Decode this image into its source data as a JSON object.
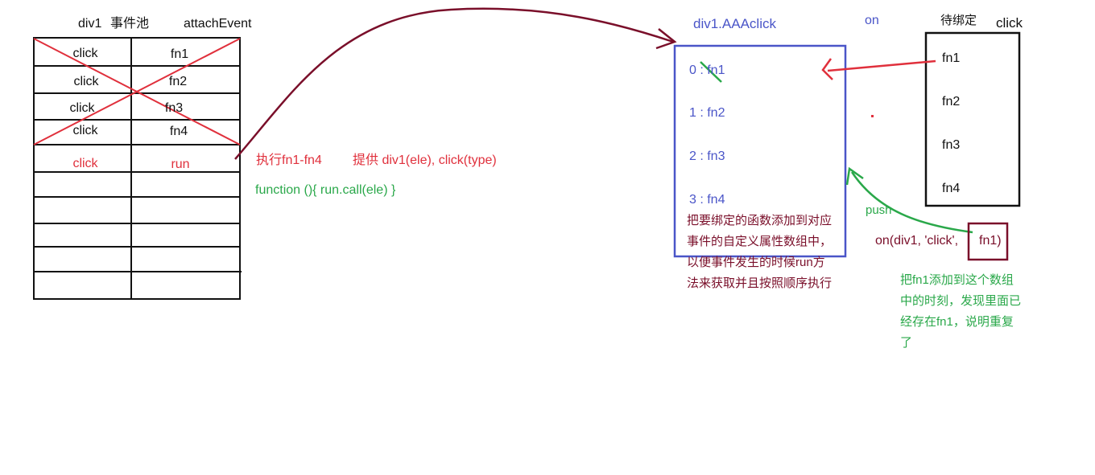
{
  "pool_table": {
    "header_div": "div1",
    "header_pool": "事件池",
    "header_api": "attachEvent",
    "rows": [
      {
        "type": "click",
        "fn": "fn1",
        "color": "#111111"
      },
      {
        "type": "click",
        "fn": "fn2",
        "color": "#111111"
      },
      {
        "type": "click",
        "fn": "fn3",
        "color": "#111111"
      },
      {
        "type": "click",
        "fn": "fn4",
        "color": "#111111"
      },
      {
        "type": "click",
        "fn": "run",
        "color": "#e0303c"
      }
    ]
  },
  "middle": {
    "exec_label": "执行fn1-fn4",
    "provide_label": "提供 div1(ele), click(type)",
    "function_label": "function (){  run.call(ele)  }"
  },
  "array_box": {
    "title": "div1.AAAclick",
    "items": [
      "0 : fn1",
      "1 : fn2",
      "2 : fn3",
      "3 : fn4"
    ],
    "note_lines": [
      "把要绑定的函数添加到对应",
      "事件的自定义属性数组中，",
      "以便事件发生的时候run方",
      "法来获取并且按照顺序执行"
    ]
  },
  "on_label": "on",
  "pending_box": {
    "title": "待绑定",
    "event": "click",
    "items": [
      "fn1",
      "fn2",
      "fn3",
      "fn4"
    ]
  },
  "push_label": "push",
  "on_call": {
    "prefix": "on(div1,  'click',",
    "fn": "fn1)"
  },
  "duplicate_note_lines": [
    "把fn1添加到这个数组",
    "中的时刻，发现里面已",
    "经存在fn1，说明重复",
    "了"
  ],
  "colors": {
    "red": "#e0303c",
    "green": "#2aa84a",
    "blue": "#4a55c8",
    "maroon": "#7a0f2a",
    "black": "#111111"
  }
}
